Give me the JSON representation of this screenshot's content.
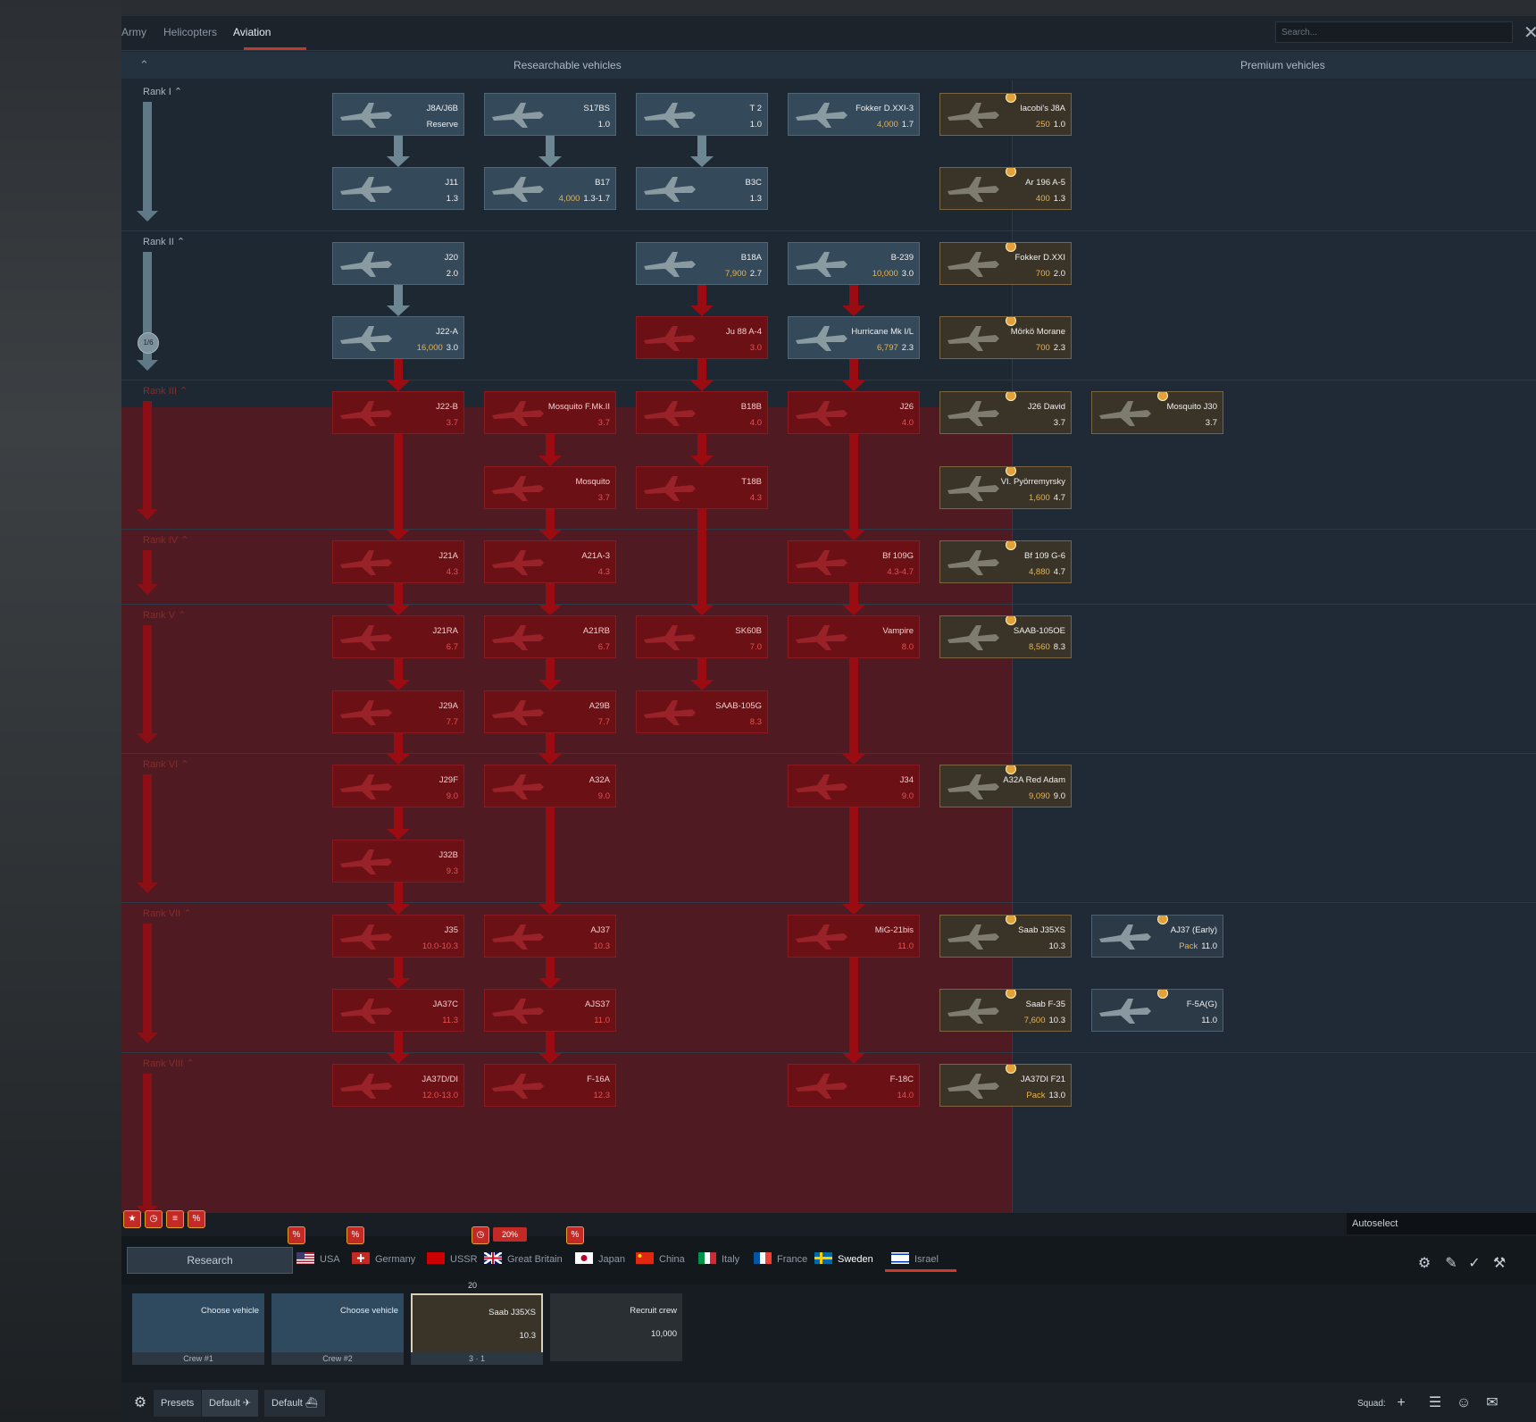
{
  "tabs": [
    {
      "label": "Army",
      "active": false
    },
    {
      "label": "Helicopters",
      "active": false
    },
    {
      "label": "Aviation",
      "active": true
    }
  ],
  "search": {
    "placeholder": "Search..."
  },
  "columns": {
    "researchable": "Researchable vehicles",
    "premium": "Premium vehicles"
  },
  "ranks": [
    {
      "label": "Rank I"
    },
    {
      "label": "Rank II",
      "progress": "1/6"
    },
    {
      "label": "Rank III"
    },
    {
      "label": "Rank IV"
    },
    {
      "label": "Rank V"
    },
    {
      "label": "Rank VI"
    },
    {
      "label": "Rank VII"
    },
    {
      "label": "Rank VIII"
    }
  ],
  "vehicles": [
    {
      "name": "J8A/J6B",
      "br": "Reserve"
    },
    {
      "name": "S17BS",
      "br": "1.0"
    },
    {
      "name": "T 2",
      "br": "1.0"
    },
    {
      "name": "Fokker D.XXI-3",
      "br": "1.7",
      "cost": "4,000"
    },
    {
      "name": "J11",
      "br": "1.3"
    },
    {
      "name": "B17",
      "br": "1.3-1.7",
      "cost": "4,000"
    },
    {
      "name": "B3C",
      "br": "1.3"
    },
    {
      "name": "J20",
      "br": "2.0"
    },
    {
      "name": "B18A",
      "br": "2.7",
      "cost": "7,900"
    },
    {
      "name": "B-239",
      "br": "3.0",
      "cost": "10,000"
    },
    {
      "name": "J22-A",
      "br": "3.0",
      "cost": "16,000"
    },
    {
      "name": "Ju 88 A-4",
      "br": "3.0"
    },
    {
      "name": "Hurricane Mk I/L",
      "br": "2.3",
      "cost": "6,797"
    },
    {
      "name": "J22-B",
      "br": "3.7"
    },
    {
      "name": "Mosquito F.Mk.II",
      "br": "3.7"
    },
    {
      "name": "B18B",
      "br": "4.0"
    },
    {
      "name": "J26",
      "br": "4.0"
    },
    {
      "name": "Mosquito",
      "br": "3.7"
    },
    {
      "name": "T18B",
      "br": "4.3"
    },
    {
      "name": "J21A",
      "br": "4.3"
    },
    {
      "name": "A21A-3",
      "br": "4.3"
    },
    {
      "name": "Bf 109G",
      "br": "4.3-4.7"
    },
    {
      "name": "J21RA",
      "br": "6.7"
    },
    {
      "name": "A21RB",
      "br": "6.7"
    },
    {
      "name": "SK60B",
      "br": "7.0"
    },
    {
      "name": "Vampire",
      "br": "8.0"
    },
    {
      "name": "J29A",
      "br": "7.7"
    },
    {
      "name": "A29B",
      "br": "7.7"
    },
    {
      "name": "SAAB-105G",
      "br": "8.3"
    },
    {
      "name": "J29F",
      "br": "9.0"
    },
    {
      "name": "A32A",
      "br": "9.0"
    },
    {
      "name": "J34",
      "br": "9.0"
    },
    {
      "name": "J32B",
      "br": "9.3"
    },
    {
      "name": "J35",
      "br": "10.0-10.3"
    },
    {
      "name": "AJ37",
      "br": "10.3"
    },
    {
      "name": "MiG-21bis",
      "br": "11.0"
    },
    {
      "name": "JA37C",
      "br": "11.3"
    },
    {
      "name": "AJS37",
      "br": "11.0"
    },
    {
      "name": "JA37D/DI",
      "br": "12.0-13.0"
    },
    {
      "name": "F-16A",
      "br": "12.3"
    },
    {
      "name": "F-18C",
      "br": "14.0"
    }
  ],
  "premium": [
    {
      "name": "Iacobi's J8A",
      "br": "1.0",
      "cost": "250"
    },
    {
      "name": "Ar 196 A-5",
      "br": "1.3",
      "cost": "400"
    },
    {
      "name": "Fokker D.XXI",
      "br": "2.0",
      "cost": "700"
    },
    {
      "name": "Mörkö Morane",
      "br": "2.3",
      "cost": "700"
    },
    {
      "name": "J26 David",
      "br": "3.7"
    },
    {
      "name": "Mosquito J30",
      "br": "3.7"
    },
    {
      "name": "VI. Pyörremyrsky",
      "br": "4.7",
      "cost": "1,600"
    },
    {
      "name": "Bf 109 G-6",
      "br": "4.7",
      "cost": "4,880"
    },
    {
      "name": "SAAB-105OE",
      "br": "8.3",
      "cost": "8,560"
    },
    {
      "name": "A32A Red Adam",
      "br": "9.0",
      "cost": "9,090"
    },
    {
      "name": "Saab J35XS",
      "br": "10.3"
    },
    {
      "name": "AJ37 (Early)",
      "br": "11.0",
      "cost": "Pack"
    },
    {
      "name": "Saab F-35",
      "br": "10.3",
      "cost": "7,600"
    },
    {
      "name": "F-5A(G)",
      "br": "11.0"
    },
    {
      "name": "JA37DI F21",
      "br": "13.0",
      "cost": "Pack"
    }
  ],
  "autoselect": "Autoselect",
  "research_label": "Research",
  "discount_label": "20%",
  "nations": [
    {
      "label": "USA"
    },
    {
      "label": "Germany"
    },
    {
      "label": "USSR"
    },
    {
      "label": "Great Britain"
    },
    {
      "label": "Japan"
    },
    {
      "label": "China"
    },
    {
      "label": "Italy"
    },
    {
      "label": "France"
    },
    {
      "label": "Sweden",
      "active": true
    },
    {
      "label": "Israel"
    }
  ],
  "crew": [
    {
      "label": "Choose vehicle",
      "tag": "Crew #1"
    },
    {
      "label": "Choose vehicle",
      "tag": "Crew #2"
    },
    {
      "label": "Saab J35XS",
      "br": "10.3",
      "count": "20",
      "crew_level": "3",
      "slot_info": "1"
    },
    {
      "label": "Recruit crew",
      "cost": "10,000"
    }
  ],
  "footer": {
    "presets": "Presets",
    "preset1": "Default",
    "preset2": "Default",
    "squad": "Squad:"
  },
  "colors": {
    "accent": "#c0392b",
    "locked": "#6b1015",
    "premium_gold": "#e3a13a"
  }
}
